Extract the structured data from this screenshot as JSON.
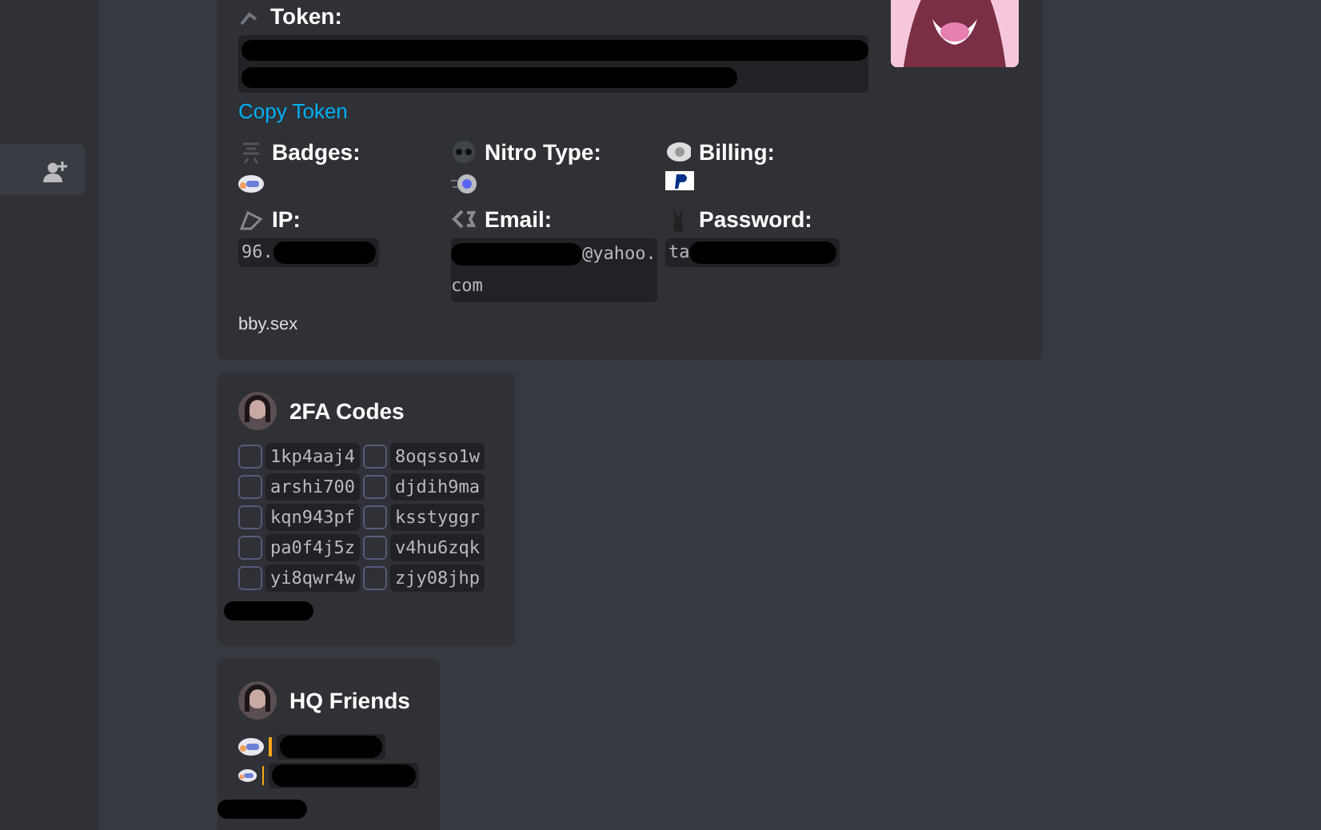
{
  "sidebar": {
    "items": [
      {
        "kind": "add-friend",
        "selected": true
      }
    ]
  },
  "account": {
    "token_label": "Token:",
    "token": {
      "redacted": true
    },
    "copy_link": "Copy Token",
    "thumbnail": true,
    "fields": [
      {
        "label": "Badges:",
        "kind": "badge"
      },
      {
        "label": "Nitro Type:",
        "kind": "nitro"
      },
      {
        "label": "Billing:",
        "kind": "paypal"
      },
      {
        "label": "IP:",
        "kind": "code",
        "value": "96.",
        "redacted": true
      },
      {
        "label": "Email:",
        "kind": "code",
        "value": "@yahoo.com",
        "redacted": true
      },
      {
        "label": "Password:",
        "kind": "code",
        "value": "ta",
        "redacted": true
      }
    ],
    "footer": "bby.sex"
  },
  "codes": {
    "title": "2FA Codes",
    "items": [
      {
        "code": "1kp4aaj4",
        "checked": false
      },
      {
        "code": "8oqsso1w",
        "checked": false
      },
      {
        "code": "arshi700",
        "checked": false
      },
      {
        "code": "djdih9ma",
        "checked": false
      },
      {
        "code": "kqn943pf",
        "checked": false
      },
      {
        "code": "ksstyggr",
        "checked": false
      },
      {
        "code": "pa0f4j5z",
        "checked": false
      },
      {
        "code": "v4hu6zqk",
        "checked": false
      },
      {
        "code": "yi8qwr4w",
        "checked": false
      },
      {
        "code": "zjy08jhp",
        "checked": false
      }
    ],
    "footer_redacted": true
  },
  "friends": {
    "title": "HQ Friends",
    "items": [
      {
        "redacted": true
      },
      {
        "redacted": true
      }
    ],
    "footer_redacted": true
  }
}
